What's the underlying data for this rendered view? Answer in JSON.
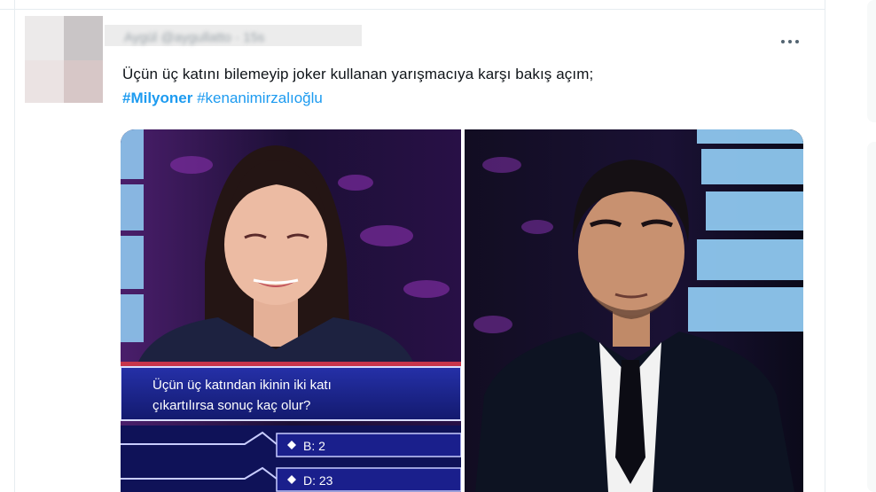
{
  "tweet": {
    "author_name": "Aygül",
    "author_handle": "@aygullatto",
    "time": "15s",
    "text": "Üçün üç katını bilemeyip joker kullanan yarışmacıya karşı bakış açım;",
    "hashtags": [
      "#Milyoner",
      "#kenanimirzalıoğlu"
    ]
  },
  "media": {
    "question_line1": "Üçün üç katından ikinin iki katı",
    "question_line2": "çıkartılırsa sonuç kaç olur?",
    "answer_b": "B: 2",
    "answer_d": "D: 23"
  },
  "colors": {
    "link": "#1d9bf0",
    "text": "#0f1419",
    "quiz_blue": "#1a1f8c"
  },
  "icons": [
    "more-icon",
    "diamond-icon"
  ]
}
